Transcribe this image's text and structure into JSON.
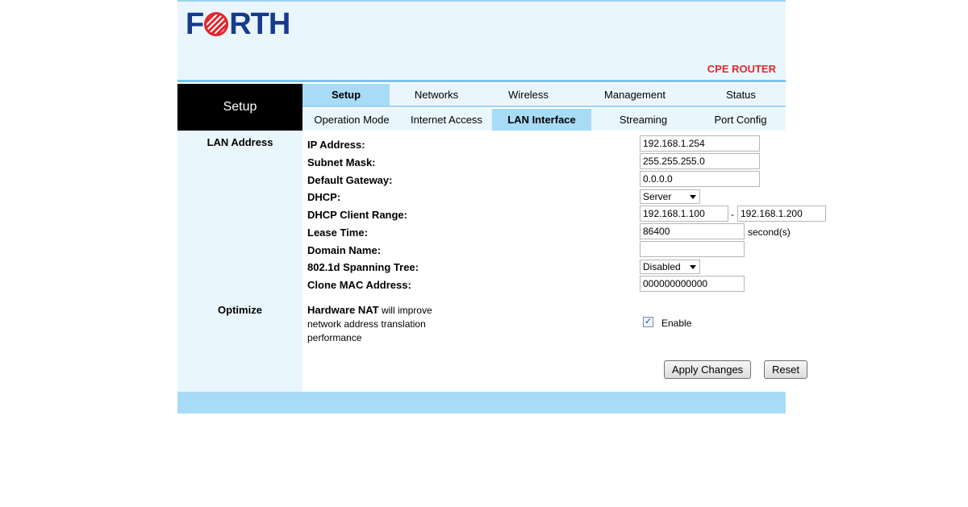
{
  "brand": {
    "logo_text_pre": "F",
    "logo_text_post": "RTH",
    "product": "CPE ROUTER"
  },
  "section_title": "Setup",
  "main_tabs": [
    "Setup",
    "Networks",
    "Wireless",
    "Management",
    "Status"
  ],
  "sub_tabs": [
    "Operation Mode",
    "Internet Access",
    "LAN Interface",
    "Streaming",
    "Port Config"
  ],
  "sections": {
    "lan": "LAN Address",
    "optimize": "Optimize"
  },
  "form": {
    "ip_label": "IP Address:",
    "ip_value": "192.168.1.254",
    "mask_label": "Subnet Mask:",
    "mask_value": "255.255.255.0",
    "gw_label": "Default Gateway:",
    "gw_value": "0.0.0.0",
    "dhcp_label": "DHCP:",
    "dhcp_value": "Server",
    "range_label": "DHCP Client Range:",
    "range_start": "192.168.1.100",
    "range_sep": "-",
    "range_end": "192.168.1.200",
    "lease_label": "Lease Time:",
    "lease_value": "86400",
    "lease_unit": "second(s)",
    "domain_label": "Domain Name:",
    "domain_value": "",
    "stp_label": "802.1d Spanning Tree:",
    "stp_value": "Disabled",
    "mac_label": "Clone MAC Address:",
    "mac_value": "000000000000"
  },
  "optimize": {
    "text_bold": "Hardware NAT",
    "text_line1_rest": " will improve",
    "text_line2": "network address translation",
    "text_line3": "performance",
    "checkbox_checked": true,
    "checkbox_label": "Enable"
  },
  "buttons": {
    "apply": "Apply Changes",
    "reset": "Reset"
  },
  "colors": {
    "brand_blue": "#173a8f",
    "brand_red": "#e3262d",
    "tab_active": "#a8dbf6",
    "panel_bg": "#eaf6fd"
  }
}
